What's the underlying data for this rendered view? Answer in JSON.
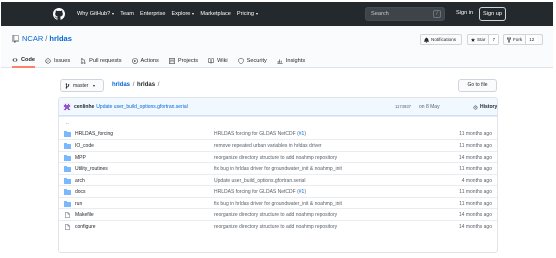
{
  "nav": {
    "why_github": "Why GitHub?",
    "team": "Team",
    "enterprise": "Enterprise",
    "explore": "Explore",
    "marketplace": "Marketplace",
    "pricing": "Pricing",
    "search_placeholder": "Search",
    "search_key": "/",
    "sign_in": "Sign in",
    "sign_up": "Sign up"
  },
  "repo": {
    "owner": "NCAR",
    "separator": "/",
    "name": "hrldas",
    "notifications_label": "Notifications",
    "star_label": "Star",
    "star_count": "7",
    "fork_label": "Fork",
    "fork_count": "12"
  },
  "tabs": [
    {
      "label": "Code",
      "icon": "code-icon",
      "active": true
    },
    {
      "label": "Issues",
      "icon": "issue-icon",
      "active": false
    },
    {
      "label": "Pull requests",
      "icon": "pull-request-icon",
      "active": false
    },
    {
      "label": "Actions",
      "icon": "play-icon",
      "active": false
    },
    {
      "label": "Projects",
      "icon": "project-icon",
      "active": false
    },
    {
      "label": "Wiki",
      "icon": "book-icon",
      "active": false
    },
    {
      "label": "Security",
      "icon": "shield-icon",
      "active": false
    },
    {
      "label": "Insights",
      "icon": "graph-icon",
      "active": false
    }
  ],
  "branch": {
    "name": "master",
    "crumb_repo": "hrldas",
    "crumb_dir": "hrldas",
    "crumb_sep": "/",
    "crumb_trail": "/",
    "go_to_file": "Go to file"
  },
  "latest_commit": {
    "author": "cenlinhe",
    "message": "Update user_build_options.gfortran.serial",
    "sha": "1174937",
    "date": "on 8 May",
    "history": "History"
  },
  "parent_dir": "..",
  "files": [
    {
      "name": "HRLDAS_forcing",
      "type": "dir",
      "msg": "HRLDAS forcing for GLDAS NetCDF (",
      "issue": "#1",
      "msg_tail": ")",
      "age": "11 months ago"
    },
    {
      "name": "IO_code",
      "type": "dir",
      "msg": "remove repeated urban variables in hrldas driver",
      "issue": "",
      "msg_tail": "",
      "age": "11 months ago"
    },
    {
      "name": "MPP",
      "type": "dir",
      "msg": "reorganize directory structure to add noahmp repository",
      "issue": "",
      "msg_tail": "",
      "age": "14 months ago"
    },
    {
      "name": "Utility_routines",
      "type": "dir",
      "msg": "fix bug in hrldas driver for groundwater_init & noahmp_init",
      "issue": "",
      "msg_tail": "",
      "age": "11 months ago"
    },
    {
      "name": "arch",
      "type": "dir",
      "msg": "Update user_build_options.gfortran.serial",
      "issue": "",
      "msg_tail": "",
      "age": "4 months ago"
    },
    {
      "name": "docs",
      "type": "dir",
      "msg": "HRLDAS forcing for GLDAS NetCDF (",
      "issue": "#1",
      "msg_tail": ")",
      "age": "11 months ago"
    },
    {
      "name": "run",
      "type": "dir",
      "msg": "fix bug in hrldas driver for groundwater_init & noahmp_init",
      "issue": "",
      "msg_tail": "",
      "age": "11 months ago"
    },
    {
      "name": "Makefile",
      "type": "file",
      "msg": "reorganize directory structure to add noahmp repository",
      "issue": "",
      "msg_tail": "",
      "age": "14 months ago"
    },
    {
      "name": "configure",
      "type": "file",
      "msg": "reorganize directory structure to add noahmp repository",
      "issue": "",
      "msg_tail": "",
      "age": "14 months ago"
    }
  ],
  "colors": {
    "nav_bg": "#24292e",
    "link": "#0366d6",
    "folder": "#79b8ff",
    "active_tab": "#f9826c",
    "commit_bar": "#f1f8ff"
  }
}
